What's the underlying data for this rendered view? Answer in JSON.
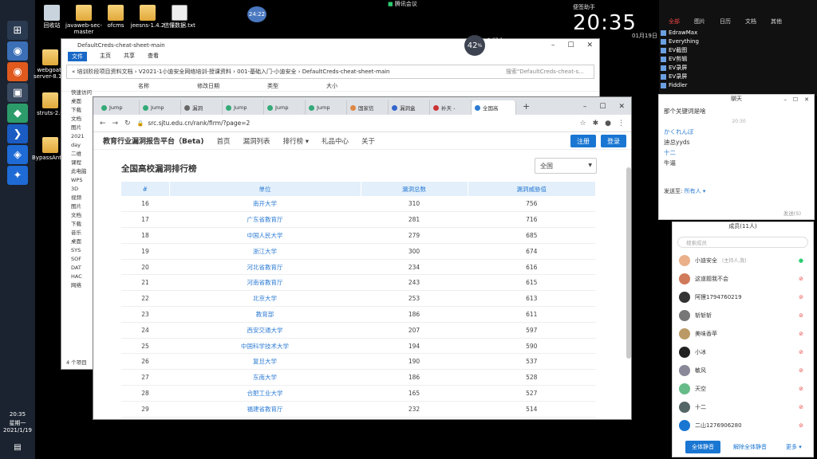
{
  "desktop": {
    "icons": [
      {
        "label": "回收站",
        "kind": "recycle"
      },
      {
        "label": "javaweb-sec-master",
        "kind": "folder"
      },
      {
        "label": "ofcms",
        "kind": "folder"
      },
      {
        "label": "jeesns-1.4.2",
        "kind": "folder"
      },
      {
        "label": "信懂数据.txt",
        "kind": "file"
      },
      {
        "label": "webgoat-server-8.1.0",
        "kind": "folder"
      },
      {
        "label": "struts-2.0",
        "kind": "folder"
      },
      {
        "label": "BypassAnti..run",
        "kind": "file"
      }
    ],
    "meeting_label": "腾讯会议",
    "small_clock": "24:22",
    "taskbar_time": "20:35",
    "taskbar_day": "星期一",
    "taskbar_date": "2021/1/19"
  },
  "perf_widget": {
    "value": "42",
    "unit": "%",
    "up": "63.1",
    "down": "44.7"
  },
  "clock_widget": {
    "time": "20:35",
    "label": "便签助手",
    "date": "01月19日"
  },
  "explorer": {
    "title": "DefaultCreds-cheat-sheet-main",
    "ribbon": [
      "文件",
      "主页",
      "共享",
      "查看"
    ],
    "address": "« 培训阶段项目资料文档 › V2021-1小迪安全网络培训-授课资料 › 001-基础入门-小迪安全 › DefaultCreds-cheat-sheet-main",
    "search_placeholder": "搜索\"DefaultCreds-cheat-s...",
    "columns": [
      "名称",
      "修改日期",
      "类型",
      "大小"
    ],
    "tree": [
      "快速访问",
      "桌面",
      "下载",
      "文档",
      "图片",
      "2021",
      "day",
      "二维",
      "课程",
      "此电脑",
      "WPS",
      "3D",
      "视频",
      "图片",
      "文档",
      "下载",
      "音乐",
      "桌面",
      "SYS",
      "SOF",
      "DAT",
      "HAC",
      "网络"
    ],
    "status": "4 个项目"
  },
  "browser": {
    "tabs": [
      "Jump",
      "Jump",
      "漏洞",
      "Jump",
      "Jump",
      "Jump",
      "国家信",
      "漏洞盒",
      "补天 -",
      "全国高"
    ],
    "url": "src.sjtu.edu.cn/rank/firm/?page=2",
    "site": {
      "brand": "教育行业漏洞报告平台（Beta)",
      "nav": [
        "首页",
        "漏洞列表",
        "排行榜 ▾",
        "礼品中心",
        "关于"
      ],
      "register": "注册",
      "login": "登录"
    },
    "page_title": "全国高校漏洞排行榜",
    "region": "全国",
    "table": {
      "headers": [
        "#",
        "单位",
        "漏洞总数",
        "漏洞威胁值"
      ],
      "rows": [
        [
          "16",
          "南开大学",
          "310",
          "756"
        ],
        [
          "17",
          "广东省教育厅",
          "281",
          "716"
        ],
        [
          "18",
          "中国人民大学",
          "279",
          "685"
        ],
        [
          "19",
          "浙江大学",
          "300",
          "674"
        ],
        [
          "20",
          "河北省教育厅",
          "234",
          "616"
        ],
        [
          "21",
          "河南省教育厅",
          "243",
          "615"
        ],
        [
          "22",
          "北京大学",
          "253",
          "613"
        ],
        [
          "23",
          "教育部",
          "186",
          "611"
        ],
        [
          "24",
          "西安交通大学",
          "207",
          "597"
        ],
        [
          "25",
          "中国科学技术大学",
          "194",
          "590"
        ],
        [
          "26",
          "复旦大学",
          "190",
          "537"
        ],
        [
          "27",
          "东南大学",
          "186",
          "528"
        ],
        [
          "28",
          "合肥工业大学",
          "165",
          "527"
        ],
        [
          "29",
          "福建省教育厅",
          "232",
          "514"
        ]
      ]
    }
  },
  "apps": [
    "EdrawMax",
    "Everything",
    "EV截图",
    "EV剪辑",
    "EV录屏",
    "EV录屏",
    "Fiddler"
  ],
  "right_tabs": [
    "全部",
    "图片",
    "日历",
    "文档",
    "其他"
  ],
  "chat": {
    "title": "聊天",
    "messages": [
      {
        "name": "",
        "text": "那个关键词是啥"
      },
      {
        "name": "",
        "text": "20:30"
      },
      {
        "name": "かくれんぼ",
        "text": "迪总yyds"
      },
      {
        "name": "十二",
        "text": "牛逼"
      }
    ],
    "send_to_label": "发送至:",
    "send_to_value": "所有人 ▾",
    "send_button": "发送(S)"
  },
  "members": {
    "title": "成员(11人)",
    "search_placeholder": "搜索成员",
    "list": [
      "小迪安全",
      "这道题我不会",
      "阿狸1794760219",
      "斩斩斩",
      "美味香苹",
      "小冰",
      "敏风",
      "天空",
      "十二",
      "二山1276906280"
    ],
    "host_note": "(主持人,我)",
    "buttons": [
      "全体静音",
      "解除全体静音",
      "更多 ▾"
    ]
  }
}
